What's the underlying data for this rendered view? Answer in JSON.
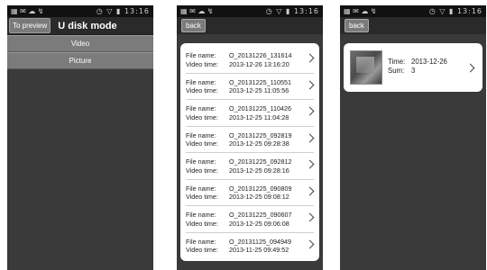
{
  "status": {
    "left": "▦ ✉ ☁ ↯",
    "right": "◷ ▽ ▮ 13:16"
  },
  "screen1": {
    "preview_button": "To preview",
    "title": "U disk mode",
    "menu": [
      "Video",
      "Picture"
    ]
  },
  "screen2": {
    "back": "back",
    "labels": {
      "file": "File name:",
      "time": "Video time:"
    },
    "rows": [
      {
        "file": "O_20131226_131614",
        "time": "2013-12-26 13:16:20"
      },
      {
        "file": "O_20131225_110551",
        "time": "2013-12-25 11:05:56"
      },
      {
        "file": "O_20131225_110426",
        "time": "2013-12-25 11:04:28"
      },
      {
        "file": "O_20131225_092819",
        "time": "2013-12-25 09:28:38"
      },
      {
        "file": "O_20131225_092812",
        "time": "2013-12-25 09:28:16"
      },
      {
        "file": "O_20131225_090809",
        "time": "2013-12-25 09:08:12"
      },
      {
        "file": "O_20131225_090607",
        "time": "2013-12-25 09:06:08"
      },
      {
        "file": "O_20131125_094949",
        "time": "2013-11-25 09:49:52"
      }
    ]
  },
  "screen3": {
    "back": "back",
    "album": {
      "time_label": "Time:",
      "time": "2013-12-26",
      "sum_label": "Sum:",
      "sum": "3"
    }
  }
}
